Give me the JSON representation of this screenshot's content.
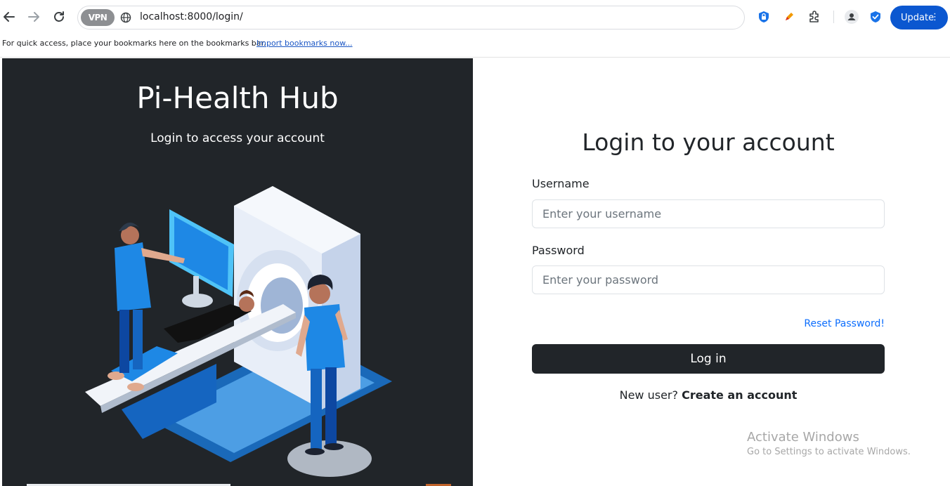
{
  "browser": {
    "vpn_label": "VPN",
    "url": "localhost:8000/login/",
    "update_label": "Update",
    "bookmarks_hint": "For quick access, place your bookmarks here on the bookmarks bar.",
    "import_bookmarks": "Import bookmarks now...",
    "accent_color": "#0b57d0"
  },
  "hero": {
    "title": "Pi-Health Hub",
    "subtitle": "Login to access your account",
    "background_color": "#212529"
  },
  "login": {
    "heading": "Login to your account",
    "username_label": "Username",
    "username_placeholder": "Enter your username",
    "password_label": "Password",
    "password_placeholder": "Enter your password",
    "reset_link": "Reset Password!",
    "submit_label": "Log in",
    "new_user_text": "New user?",
    "create_account": "Create an account"
  },
  "watermark": {
    "line1": "Activate Windows",
    "line2": "Go to Settings to activate Windows."
  }
}
